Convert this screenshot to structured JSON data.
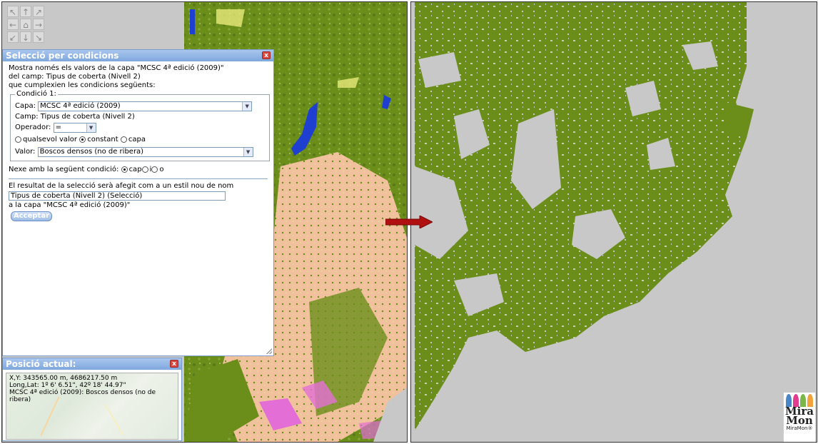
{
  "navigation": {
    "buttons": [
      "↖",
      "↑",
      "↗",
      "←",
      "⌂",
      "→",
      "↙",
      "↓",
      "↘"
    ]
  },
  "selection_dialog": {
    "title": "Selecció per condicions",
    "intro_line1": "Mostra només els valors de la capa \"MCSC 4ª edició (2009)\"",
    "intro_line2": "del camp: Tipus de coberta (Nivell 2)",
    "intro_line3": "que cumplexien les condicions següents:",
    "condition": {
      "legend": "Condició 1:",
      "layer_label": "Capa:",
      "layer_value": "MCSC 4ª edició (2009)",
      "field_text": "Camp: Tipus de coberta (Nivell 2)",
      "operator_label": "Operador:",
      "operator_value": "=",
      "radio_any": "qualsevol valor",
      "radio_constant": "constant",
      "radio_layer": "capa",
      "value_label": "Valor:",
      "value_value": "Boscos densos (no de ribera)"
    },
    "next_label": "Nexe amb la següent condició:",
    "next_none": "cap",
    "next_and": "i",
    "next_or": "o",
    "result_text": "El resultat de la selecció serà afegit com a un estil nou de nom",
    "style_name": "Tipus de coberta (Nivell 2) (Selecció)",
    "target_layer": "a la capa \"MCSC 4ª edició (2009)\"",
    "accept_label": "Acceptar",
    "close_symbol": "x"
  },
  "position_dialog": {
    "title": "Posició actual:",
    "xy": "X,Y: 343565.00 m, 4686217.50 m",
    "longlat": "Long,Lat: 1º 6' 6.51\", 42º 18' 44.97\"",
    "layer_value": "MCSC 4ª edició (2009): Boscos densos (no de ribera)",
    "close_symbol": "x"
  },
  "logo": {
    "line1": "Mira",
    "line2": "Mon",
    "tagline": "MiraMon®"
  },
  "colors": {
    "forest": "#6b8e1a",
    "forest_dark": "#4f7012",
    "crop": "#f3c4a0",
    "background": "#c8c8c8",
    "water": "#1f3fd0",
    "urban": "#e36fd6",
    "arrow": "#b01010"
  }
}
